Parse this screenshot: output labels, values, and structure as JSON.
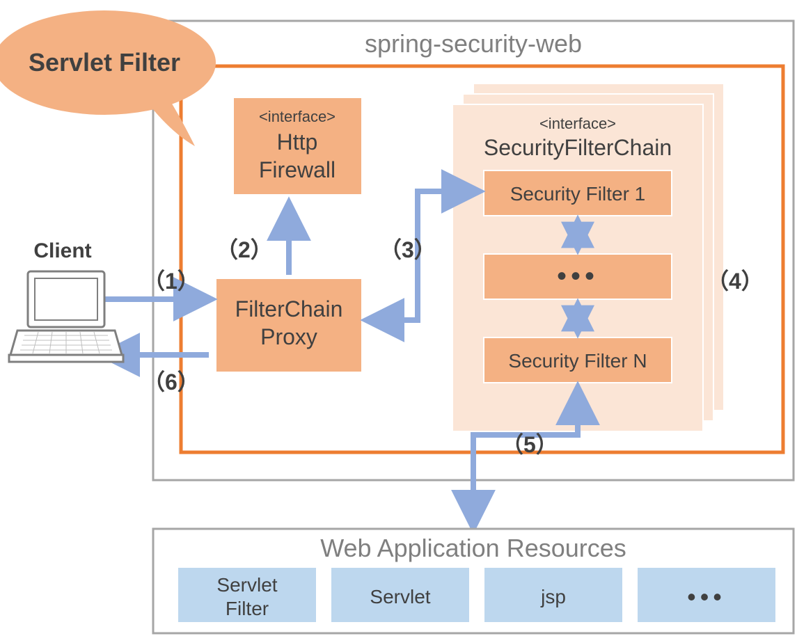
{
  "callout": {
    "label": "Servlet Filter"
  },
  "client": {
    "label": "Client"
  },
  "outer": {
    "title": "spring-security-web"
  },
  "firewall": {
    "stereotype": "<interface>",
    "name1": "Http",
    "name2": "Firewall"
  },
  "proxy": {
    "name1": "FilterChain",
    "name2": "Proxy"
  },
  "chain": {
    "stereotype": "<interface>",
    "name": "SecurityFilterChain",
    "filter1": "Security Filter 1",
    "filterN": "Security Filter N",
    "ellipsis": "•••"
  },
  "steps": {
    "s1": "（1）",
    "s2": "（2）",
    "s3": "（3）",
    "s4": "（4）",
    "s5": "（5）",
    "s6": "（6）"
  },
  "resources": {
    "title": "Web Application Resources",
    "r1a": "Servlet",
    "r1b": "Filter",
    "r2": "Servlet",
    "r3": "jsp",
    "r4": "•••"
  },
  "colors": {
    "orange_fill": "#f4b183",
    "orange_stroke": "#ed7d31",
    "orange_light": "#fbe5d6",
    "blue_fill": "#bdd7ee",
    "blue_stroke": "#9dc3e6",
    "arrow": "#8faadc",
    "gray_stroke": "#a6a6a6",
    "gray_text": "#7f7f7f"
  }
}
